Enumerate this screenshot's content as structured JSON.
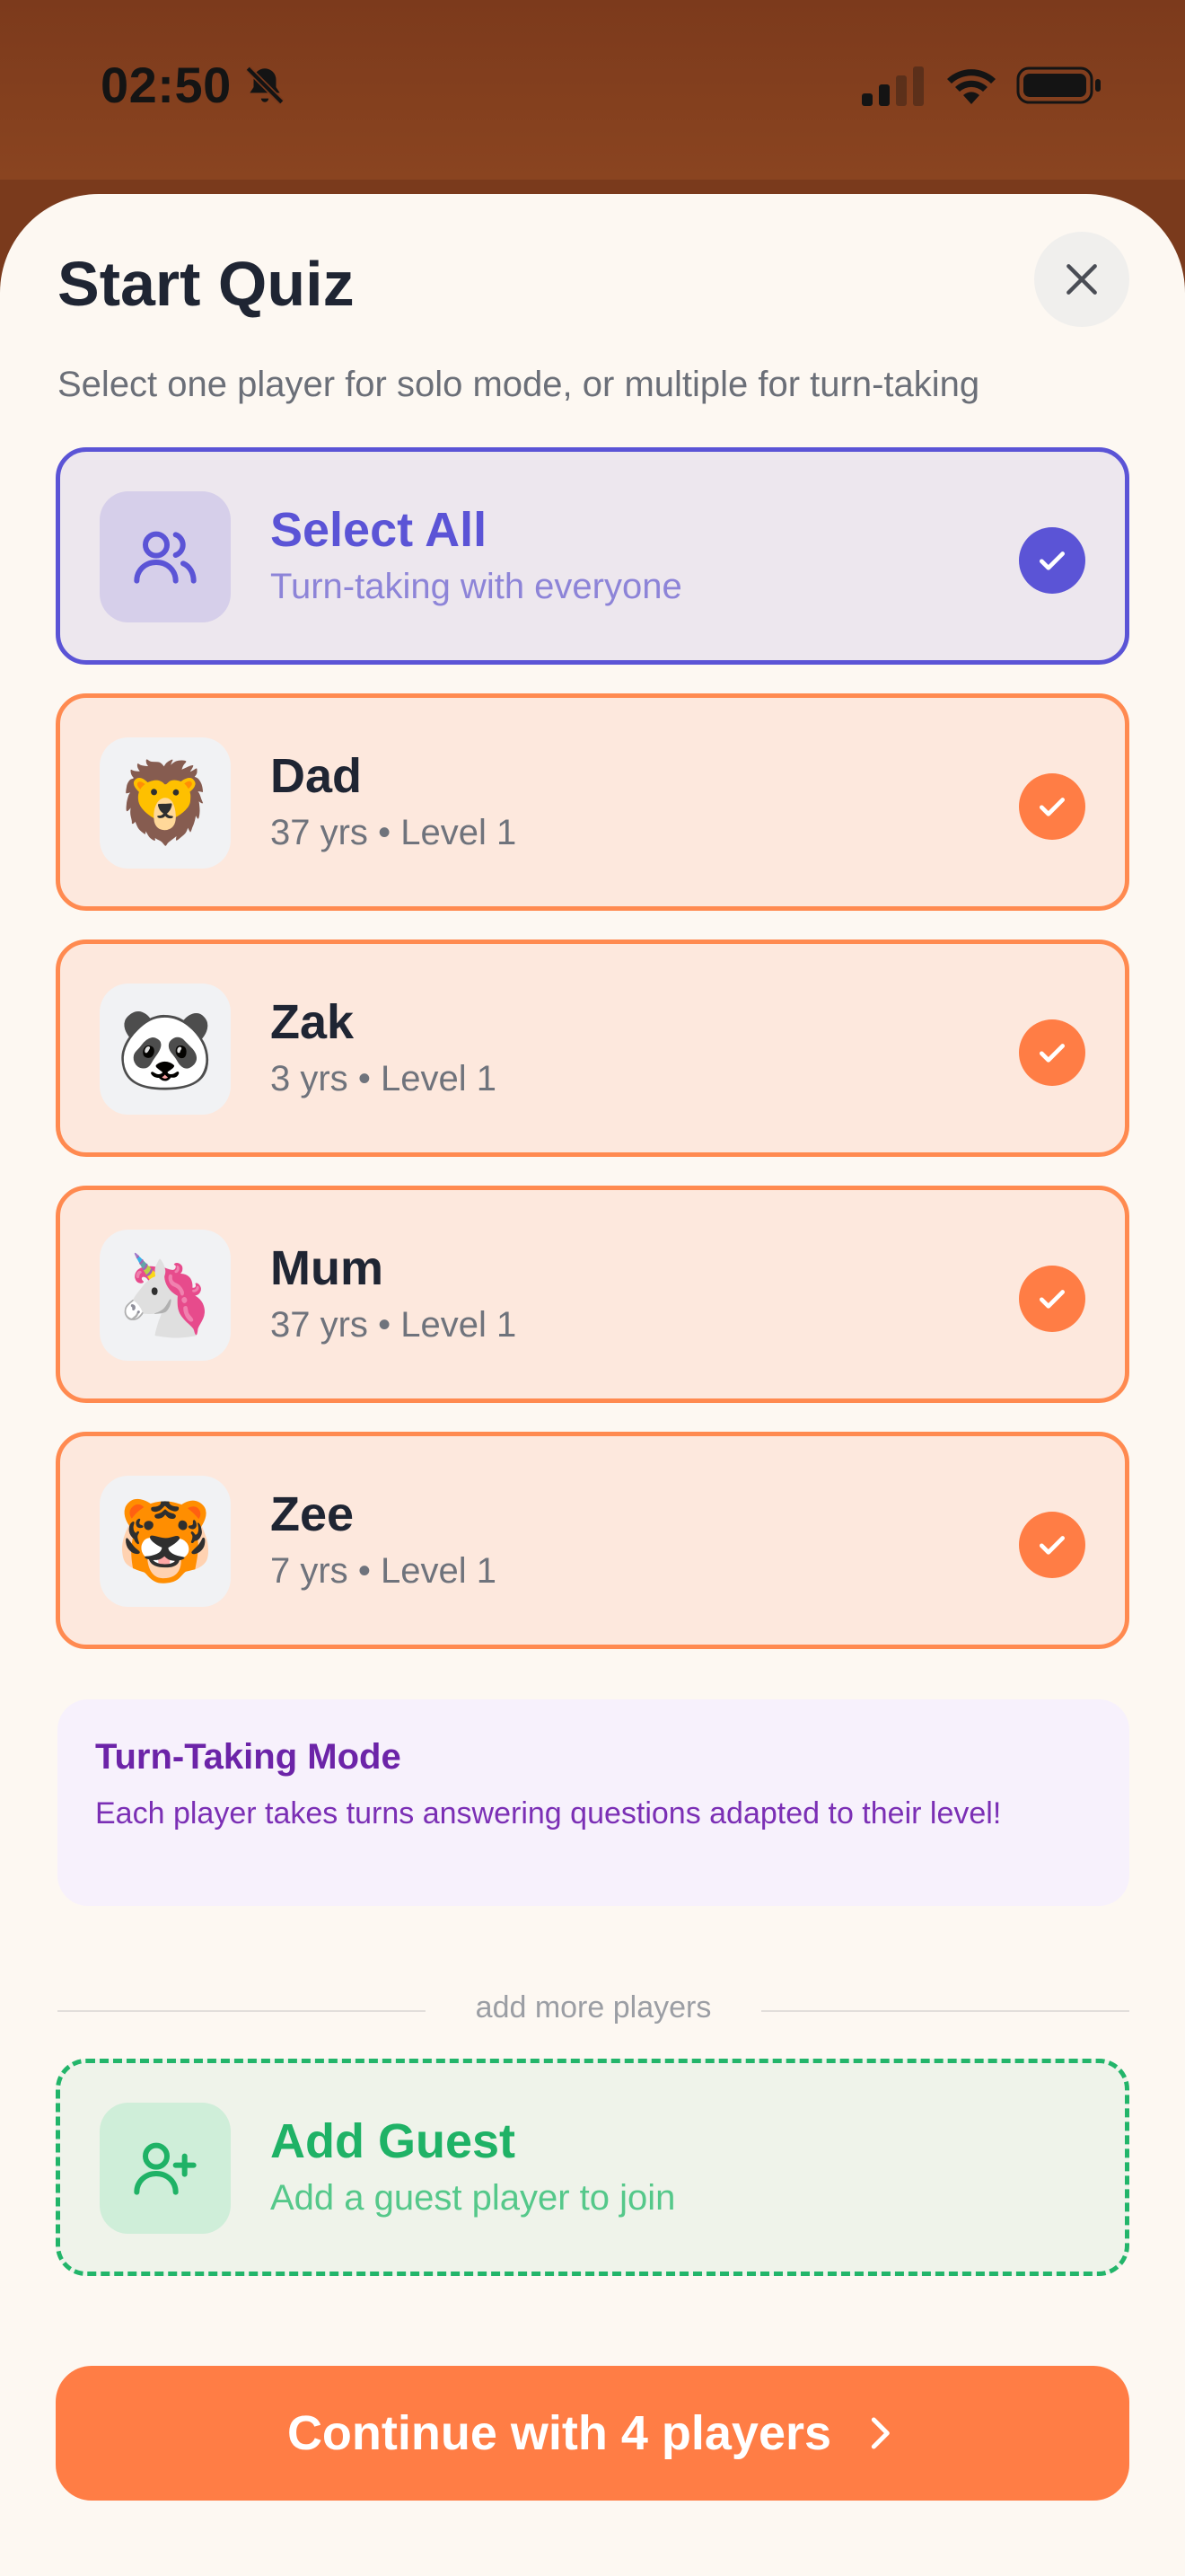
{
  "status_bar": {
    "time": "02:50",
    "icons": [
      "bell-slash-icon",
      "signal-icon",
      "wifi-icon",
      "battery-icon"
    ]
  },
  "sheet": {
    "title": "Start Quiz",
    "close_icon": "close-icon",
    "subtitle": "Select one player for solo mode, or multiple for turn-taking"
  },
  "select_all": {
    "name": "Select All",
    "description": "Turn-taking with everyone",
    "icon": "users-icon",
    "selected": true,
    "color": "#5b54d6"
  },
  "players": [
    {
      "name": "Dad",
      "avatar": "🦁",
      "age": "37 yrs",
      "level": "Level 1",
      "selected": true
    },
    {
      "name": "Zak",
      "avatar": "🐼",
      "age": "3 yrs",
      "level": "Level 1",
      "selected": true
    },
    {
      "name": "Mum",
      "avatar": "🦄",
      "age": "37 yrs",
      "level": "Level 1",
      "selected": true
    },
    {
      "name": "Zee",
      "avatar": "🐯",
      "age": "7 yrs",
      "level": "Level 1",
      "selected": true
    }
  ],
  "meta_separator": "•",
  "turn_taking": {
    "title": "Turn-Taking Mode",
    "text": "Each player takes turns answering questions adapted to their level!"
  },
  "divider_label": "add more players",
  "add_guest": {
    "name": "Add Guest",
    "description": "Add a guest player to join",
    "icon": "user-plus-icon",
    "color": "#22b56a"
  },
  "continue_button": {
    "label": "Continue with 4 players",
    "icon": "chevron-right-icon",
    "color": "#ff7d45"
  },
  "colors": {
    "accent": "#ff7d45",
    "primary_text": "#1f2533",
    "sheet_background": "#fdf8f2"
  }
}
